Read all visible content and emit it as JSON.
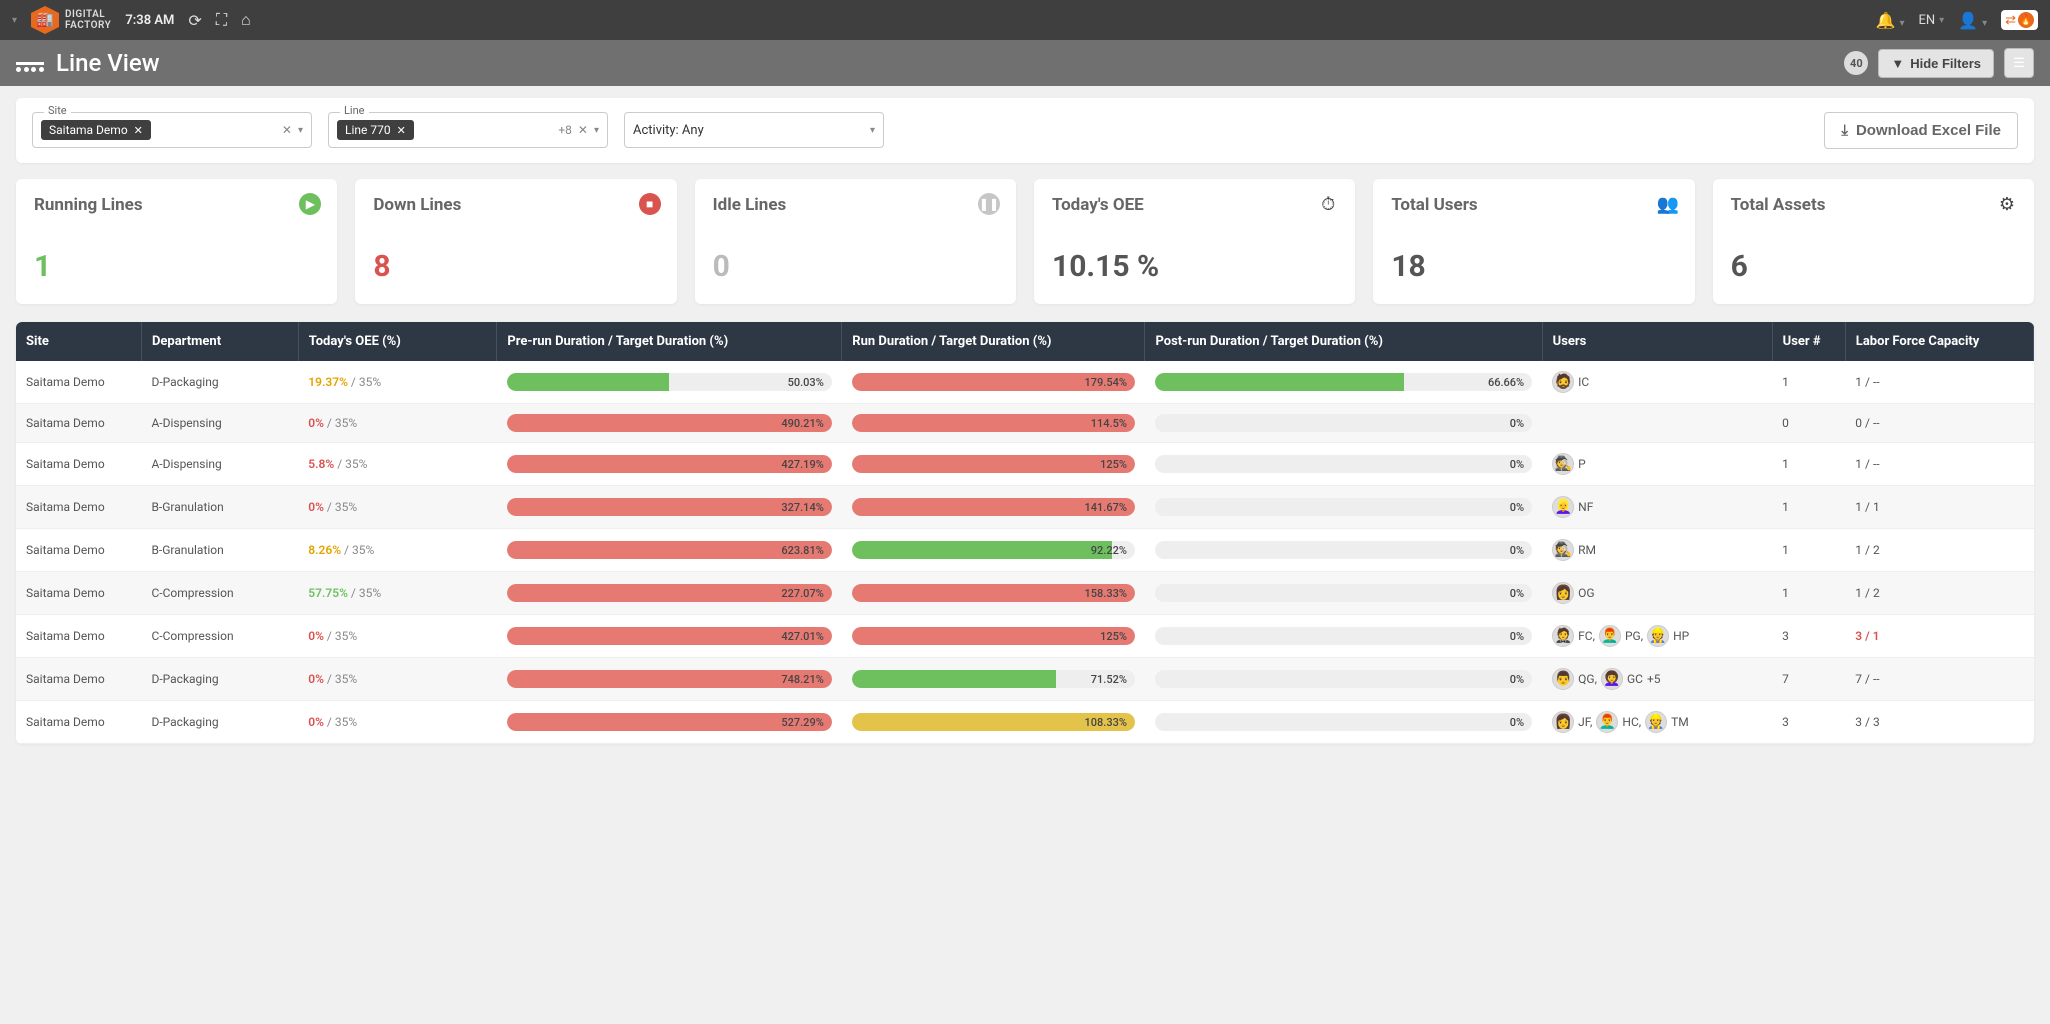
{
  "topbar": {
    "time": "7:38 AM",
    "lang": "EN",
    "logo_top": "DIGITAL",
    "logo_bottom": "FACTORY"
  },
  "header": {
    "title": "Line View",
    "badge": "40",
    "hide_filters": "Hide Filters"
  },
  "filters": {
    "site_label": "Site",
    "site_chip": "Saitama Demo",
    "line_label": "Line",
    "line_chip": "Line 770",
    "line_extra": "+8",
    "activity": "Activity: Any",
    "download": "Download Excel File"
  },
  "stats": [
    {
      "title": "Running Lines",
      "value": "1",
      "vclass": "c-green",
      "iclass": "ic-play",
      "glyph": "▶"
    },
    {
      "title": "Down Lines",
      "value": "8",
      "vclass": "c-red",
      "iclass": "ic-stop",
      "glyph": "■"
    },
    {
      "title": "Idle Lines",
      "value": "0",
      "vclass": "c-gray",
      "iclass": "ic-pause",
      "glyph": "❚❚"
    },
    {
      "title": "Today's OEE",
      "value": "10.15 %",
      "vclass": "",
      "iclass": "ic-plain",
      "glyph": "⏱"
    },
    {
      "title": "Total Users",
      "value": "18",
      "vclass": "",
      "iclass": "ic-plain",
      "glyph": "👥"
    },
    {
      "title": "Total Assets",
      "value": "6",
      "vclass": "",
      "iclass": "ic-plain",
      "glyph": "⚙"
    }
  ],
  "table": {
    "headers": [
      "Site",
      "Department",
      "Today's OEE (%)",
      "Pre-run Duration / Target Duration (%)",
      "Run Duration / Target Duration (%)",
      "Post-run Duration / Target Duration (%)",
      "Users",
      "User #",
      "Labor Force Capacity"
    ],
    "col_widths": [
      "6%",
      "7.5%",
      "9.5%",
      "16.5%",
      "14.5%",
      "19%",
      "11%",
      "3.5%",
      "9%"
    ],
    "rows": [
      {
        "site": "Saitama Demo",
        "dept": "D-Packaging",
        "oee_v": "19.37%",
        "oee_c": "y",
        "oee_t": " / 35%",
        "pre": {
          "pct": 50,
          "color": "green",
          "label": "50.03%"
        },
        "run": {
          "pct": 100,
          "color": "red",
          "label": "179.54%"
        },
        "post": {
          "pct": 66,
          "color": "green",
          "label": "66.66%"
        },
        "users": [
          {
            "e": "🧔",
            "n": "IC"
          }
        ],
        "more": "",
        "unum": "1",
        "lfc": "1 / --",
        "lfc_red": false
      },
      {
        "site": "Saitama Demo",
        "dept": "A-Dispensing",
        "oee_v": "0%",
        "oee_c": "r",
        "oee_t": " / 35%",
        "pre": {
          "pct": 100,
          "color": "red",
          "label": "490.21%"
        },
        "run": {
          "pct": 100,
          "color": "red",
          "label": "114.5%"
        },
        "post": {
          "pct": 0,
          "color": "",
          "label": "0%"
        },
        "users": [],
        "more": "",
        "unum": "0",
        "lfc": "0 / --",
        "lfc_red": false
      },
      {
        "site": "Saitama Demo",
        "dept": "A-Dispensing",
        "oee_v": "5.8%",
        "oee_c": "r",
        "oee_t": " / 35%",
        "pre": {
          "pct": 100,
          "color": "red",
          "label": "427.19%"
        },
        "run": {
          "pct": 100,
          "color": "red",
          "label": "125%"
        },
        "post": {
          "pct": 0,
          "color": "",
          "label": "0%"
        },
        "users": [
          {
            "e": "🕵️",
            "n": "P"
          }
        ],
        "more": "",
        "unum": "1",
        "lfc": "1 / --",
        "lfc_red": false
      },
      {
        "site": "Saitama Demo",
        "dept": "B-Granulation",
        "oee_v": "0%",
        "oee_c": "r",
        "oee_t": " / 35%",
        "pre": {
          "pct": 100,
          "color": "red",
          "label": "327.14%"
        },
        "run": {
          "pct": 100,
          "color": "red",
          "label": "141.67%"
        },
        "post": {
          "pct": 0,
          "color": "",
          "label": "0%"
        },
        "users": [
          {
            "e": "👱‍♀️",
            "n": "NF"
          }
        ],
        "more": "",
        "unum": "1",
        "lfc": "1 / 1",
        "lfc_red": false
      },
      {
        "site": "Saitama Demo",
        "dept": "B-Granulation",
        "oee_v": "8.26%",
        "oee_c": "y",
        "oee_t": " / 35%",
        "pre": {
          "pct": 100,
          "color": "red",
          "label": "623.81%"
        },
        "run": {
          "pct": 92,
          "color": "green",
          "label": "92.22%"
        },
        "post": {
          "pct": 0,
          "color": "",
          "label": "0%"
        },
        "users": [
          {
            "e": "🕵️",
            "n": "RM"
          }
        ],
        "more": "",
        "unum": "1",
        "lfc": "1 / 2",
        "lfc_red": false
      },
      {
        "site": "Saitama Demo",
        "dept": "C-Compression",
        "oee_v": "57.75%",
        "oee_c": "g",
        "oee_t": " / 35%",
        "pre": {
          "pct": 100,
          "color": "red",
          "label": "227.07%"
        },
        "run": {
          "pct": 100,
          "color": "red",
          "label": "158.33%"
        },
        "post": {
          "pct": 0,
          "color": "",
          "label": "0%"
        },
        "users": [
          {
            "e": "👩",
            "n": "OG"
          }
        ],
        "more": "",
        "unum": "1",
        "lfc": "1 / 2",
        "lfc_red": false
      },
      {
        "site": "Saitama Demo",
        "dept": "C-Compression",
        "oee_v": "0%",
        "oee_c": "r",
        "oee_t": " / 35%",
        "pre": {
          "pct": 100,
          "color": "red",
          "label": "427.01%"
        },
        "run": {
          "pct": 100,
          "color": "red",
          "label": "125%"
        },
        "post": {
          "pct": 0,
          "color": "",
          "label": "0%"
        },
        "users": [
          {
            "e": "🤵",
            "n": "FC,"
          },
          {
            "e": "👨‍🦰",
            "n": "PG,"
          },
          {
            "e": "👷",
            "n": "HP"
          }
        ],
        "more": "",
        "unum": "3",
        "lfc": "3 / 1",
        "lfc_red": true
      },
      {
        "site": "Saitama Demo",
        "dept": "D-Packaging",
        "oee_v": "0%",
        "oee_c": "r",
        "oee_t": " / 35%",
        "pre": {
          "pct": 100,
          "color": "red",
          "label": "748.21%"
        },
        "run": {
          "pct": 72,
          "color": "green",
          "label": "71.52%"
        },
        "post": {
          "pct": 0,
          "color": "",
          "label": "0%"
        },
        "users": [
          {
            "e": "👨",
            "n": "QG,"
          },
          {
            "e": "👩‍🦱",
            "n": "GC"
          }
        ],
        "more": "+5",
        "unum": "7",
        "lfc": "7 / --",
        "lfc_red": false
      },
      {
        "site": "Saitama Demo",
        "dept": "D-Packaging",
        "oee_v": "0%",
        "oee_c": "r",
        "oee_t": " / 35%",
        "pre": {
          "pct": 100,
          "color": "red",
          "label": "527.29%"
        },
        "run": {
          "pct": 100,
          "color": "yellow",
          "label": "108.33%"
        },
        "post": {
          "pct": 0,
          "color": "",
          "label": "0%"
        },
        "users": [
          {
            "e": "👩",
            "n": "JF,"
          },
          {
            "e": "👨‍🦰",
            "n": "HC,"
          },
          {
            "e": "👷",
            "n": "TM"
          }
        ],
        "more": "",
        "unum": "3",
        "lfc": "3 / 3",
        "lfc_red": false
      }
    ]
  }
}
